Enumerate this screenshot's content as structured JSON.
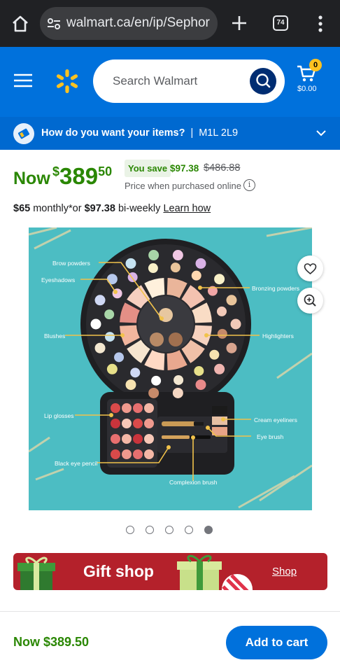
{
  "browser": {
    "url": "walmart.ca/en/ip/Sephor",
    "tab_count": "74"
  },
  "header": {
    "search_placeholder": "Search Walmart",
    "cart_count": "0",
    "cart_total": "$0.00",
    "colors": {
      "brand_blue": "#0071dc",
      "spark_yellow": "#ffc220"
    }
  },
  "delivery": {
    "question": "How do you want your items?",
    "separator": "|",
    "postal_code": "M1L 2L9"
  },
  "price": {
    "now_label": "Now",
    "currency": "$",
    "dollars": "389",
    "cents": "50",
    "you_save_label": "You save",
    "save_amount": "$97.38",
    "was_price": "$486.88",
    "online_note": "Price when purchased online",
    "info_glyph": "i"
  },
  "financing": {
    "monthly_amount": "$65",
    "monthly_text": " monthly*or ",
    "biweekly_amount": "$97.38",
    "biweekly_text": " bi-weekly ",
    "learn_how": "Learn how"
  },
  "product_image": {
    "labels": {
      "brow_powders": "Brow powders",
      "eyeshadows": "Eyeshadows",
      "bronzing_powders": "Bronzing powders",
      "blushes": "Blushes",
      "highlighters": "Highlighters",
      "lip_glosses": "Lip glosses",
      "cream_eyeliners": "Cream eyeliners",
      "eye_brush": "Eye brush",
      "black_eye_pencil": "Black eye pencil",
      "complexion_brush": "Complexion brush"
    },
    "carousel": {
      "total": 5,
      "active_index": 4
    }
  },
  "gift_banner": {
    "title": "Gift shop",
    "link": "Shop"
  },
  "bottom_bar": {
    "price": "Now $389.50",
    "add_to_cart": "Add to cart"
  }
}
